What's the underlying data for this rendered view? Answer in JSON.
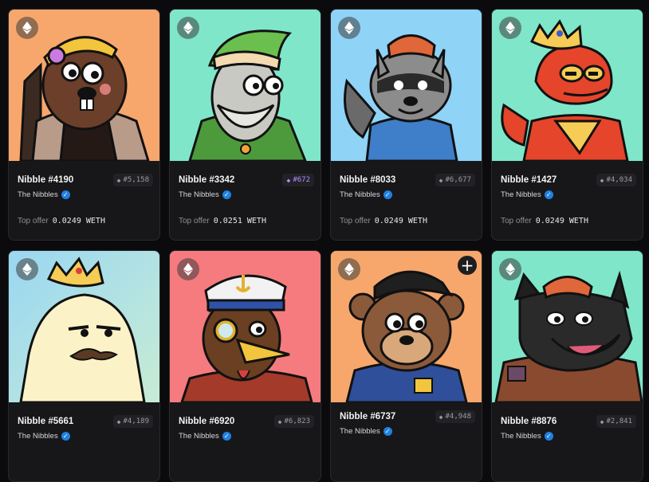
{
  "colors": {
    "card_bg": "#17171a",
    "verified": "#2081e2",
    "rarity_purple": "#b58cff"
  },
  "cards": [
    {
      "name": "Nibble #4190",
      "rank": "#5,158",
      "rank_style": "gray",
      "collection": "The Nibbles",
      "offer_label": "Top offer",
      "offer_value": "0.0249 WETH",
      "bg": "#f7a76c",
      "art": "beaver-with-hardhat"
    },
    {
      "name": "Nibble #3342",
      "rank": "#672",
      "rank_style": "purple",
      "collection": "The Nibbles",
      "offer_label": "Top offer",
      "offer_value": "0.0251 WETH",
      "bg": "#7fe6c9",
      "art": "old-wizard"
    },
    {
      "name": "Nibble #8033",
      "rank": "#6,677",
      "rank_style": "gray",
      "collection": "The Nibbles",
      "offer_label": "Top offer",
      "offer_value": "0.0249 WETH",
      "bg": "#8fd3f7",
      "art": "raccoon-in-beanie"
    },
    {
      "name": "Nibble #1427",
      "rank": "#4,034",
      "rank_style": "gray",
      "collection": "The Nibbles",
      "offer_label": "Top offer",
      "offer_value": "0.0249 WETH",
      "bg": "#7fe6c9",
      "art": "lizard-with-crown"
    },
    {
      "name": "Nibble #5661",
      "rank": "#4,189",
      "rank_style": "gray",
      "collection": "The Nibbles",
      "bg": "#9ad7f2",
      "art": "bear-with-crown"
    },
    {
      "name": "Nibble #6920",
      "rank": "#6,823",
      "rank_style": "gray",
      "collection": "The Nibbles",
      "bg": "#f67b7e",
      "art": "captain-bird"
    },
    {
      "name": "Nibble #6737",
      "rank": "#4,948",
      "rank_style": "gray",
      "collection": "The Nibbles",
      "bg": "#f7a76c",
      "art": "bear-in-cap",
      "has_add_button": true
    },
    {
      "name": "Nibble #8876",
      "rank": "#2,841",
      "rank_style": "gray",
      "collection": "The Nibbles",
      "bg": "#7fe6c9",
      "art": "wolf-in-beanie"
    }
  ]
}
